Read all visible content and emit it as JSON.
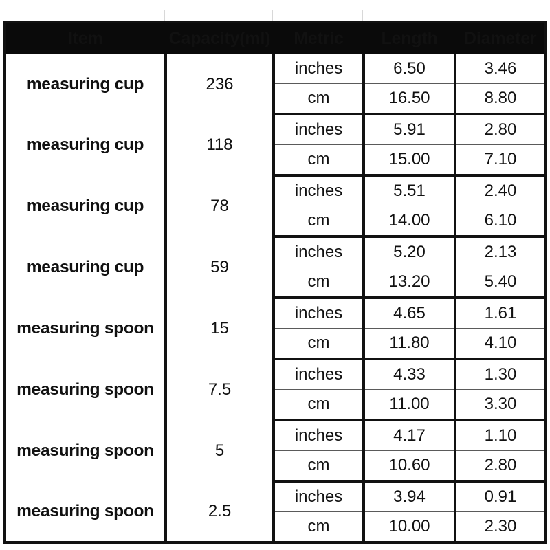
{
  "table": {
    "name": "measuring-cup-spoon-size-chart",
    "columns": [
      {
        "key": "item",
        "label": "Item"
      },
      {
        "key": "capacity",
        "label": "Capacity(ml)"
      },
      {
        "key": "metric",
        "label": "Metric"
      },
      {
        "key": "length",
        "label": "Length"
      },
      {
        "key": "diameter",
        "label": "Diameter"
      }
    ],
    "metric_labels": {
      "inches": "inches",
      "cm": "cm"
    },
    "colors": {
      "header_background": "#0a0a0a",
      "header_text": "#ffffff",
      "border": "#111111",
      "inner_divider": "#5a5a5a",
      "body_background": "#ffffff",
      "body_text": "#111111"
    },
    "rows": [
      {
        "item": "measuring cup",
        "capacity": "236",
        "inches": {
          "metric": "inches",
          "length": "6.50",
          "diameter": "3.46"
        },
        "cm": {
          "metric": "cm",
          "length": "16.50",
          "diameter": "8.80"
        }
      },
      {
        "item": "measuring cup",
        "capacity": "118",
        "inches": {
          "metric": "inches",
          "length": "5.91",
          "diameter": "2.80"
        },
        "cm": {
          "metric": "cm",
          "length": "15.00",
          "diameter": "7.10"
        }
      },
      {
        "item": "measuring cup",
        "capacity": "78",
        "inches": {
          "metric": "inches",
          "length": "5.51",
          "diameter": "2.40"
        },
        "cm": {
          "metric": "cm",
          "length": "14.00",
          "diameter": "6.10"
        }
      },
      {
        "item": "measuring cup",
        "capacity": "59",
        "inches": {
          "metric": "inches",
          "length": "5.20",
          "diameter": "2.13"
        },
        "cm": {
          "metric": "cm",
          "length": "13.20",
          "diameter": "5.40"
        }
      },
      {
        "item": "measuring spoon",
        "capacity": "15",
        "inches": {
          "metric": "inches",
          "length": "4.65",
          "diameter": "1.61"
        },
        "cm": {
          "metric": "cm",
          "length": "11.80",
          "diameter": "4.10"
        }
      },
      {
        "item": "measuring spoon",
        "capacity": "7.5",
        "inches": {
          "metric": "inches",
          "length": "4.33",
          "diameter": "1.30"
        },
        "cm": {
          "metric": "cm",
          "length": "11.00",
          "diameter": "3.30"
        }
      },
      {
        "item": "measuring spoon",
        "capacity": "5",
        "inches": {
          "metric": "inches",
          "length": "4.17",
          "diameter": "1.10"
        },
        "cm": {
          "metric": "cm",
          "length": "10.60",
          "diameter": "2.80"
        }
      },
      {
        "item": "measuring spoon",
        "capacity": "2.5",
        "inches": {
          "metric": "inches",
          "length": "3.94",
          "diameter": "0.91"
        },
        "cm": {
          "metric": "cm",
          "length": "10.00",
          "diameter": "2.30"
        }
      }
    ]
  }
}
